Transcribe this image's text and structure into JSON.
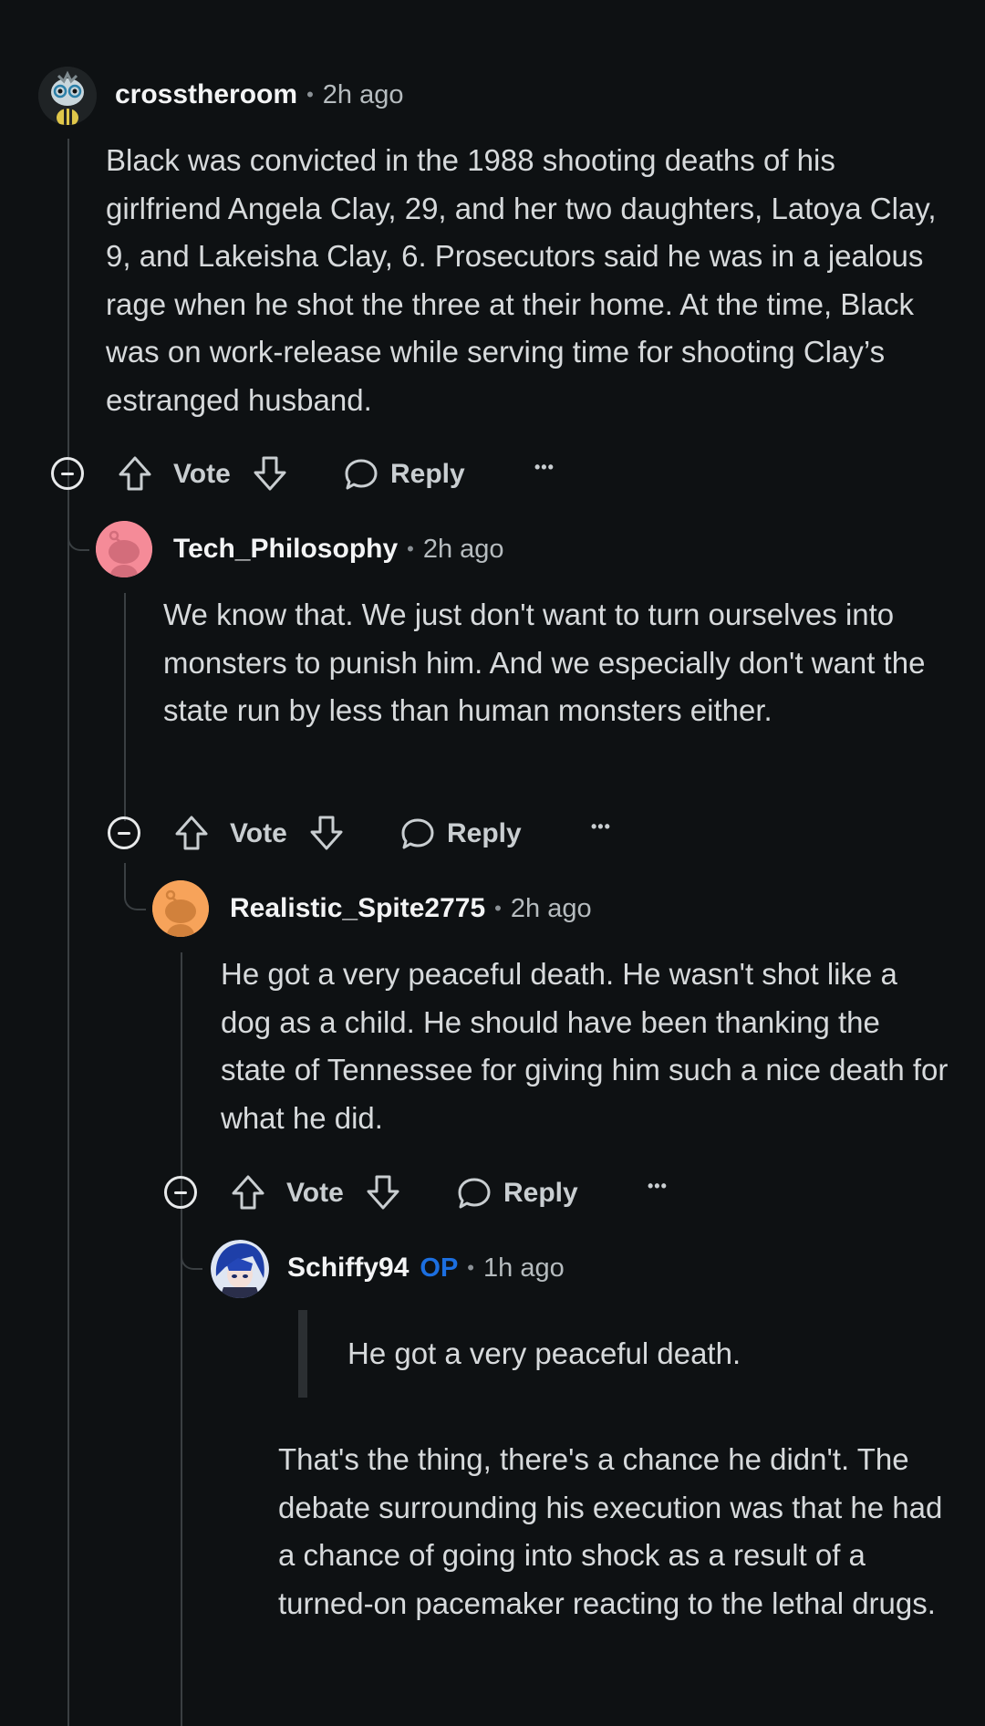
{
  "comments": [
    {
      "user": "crosstheroom",
      "time": "2h ago",
      "body": "Black was convicted in the 1988 shooting deaths of his girlfriend Angela Clay, 29, and her two daughters, Latoya Clay, 9, and Lakeisha Clay, 6. Prosecutors said he was in a jealous rage when he shot the three at their home. At the time, Black was on work-release while serving time for shooting Clay’s estranged husband.",
      "vote_label": "Vote",
      "reply_label": "Reply",
      "more_label": "•••"
    },
    {
      "user": "Tech_Philosophy",
      "time": "2h ago",
      "body": "We know that. We just don't want to turn ourselves into monsters to punish him. And we especially don't want the state run by less than human monsters either.",
      "vote_label": "Vote",
      "reply_label": "Reply",
      "more_label": "•••"
    },
    {
      "user": "Realistic_Spite2775",
      "time": "2h ago",
      "body": "He got a very peaceful death. He wasn't shot like a dog as a child. He should have been thanking the state of Tennessee for giving him such a nice death for what he did.",
      "vote_label": "Vote",
      "reply_label": "Reply",
      "more_label": "•••"
    },
    {
      "user": "Schiffy94",
      "op_badge": "OP",
      "time": "1h ago",
      "quote": "He got a very peaceful death.",
      "body": "That's the thing, there's a chance he didn't. The debate surrounding his execution was that he had a chance of going into shock as a result of a turned-on pacemaker reacting to the lethal drugs."
    }
  ],
  "meta_separator": "•",
  "colors": {
    "background": "#0e1113",
    "op_badge": "#1c6fe0",
    "avatar_pink": "#f58b98",
    "avatar_orange": "#f7a35a"
  }
}
